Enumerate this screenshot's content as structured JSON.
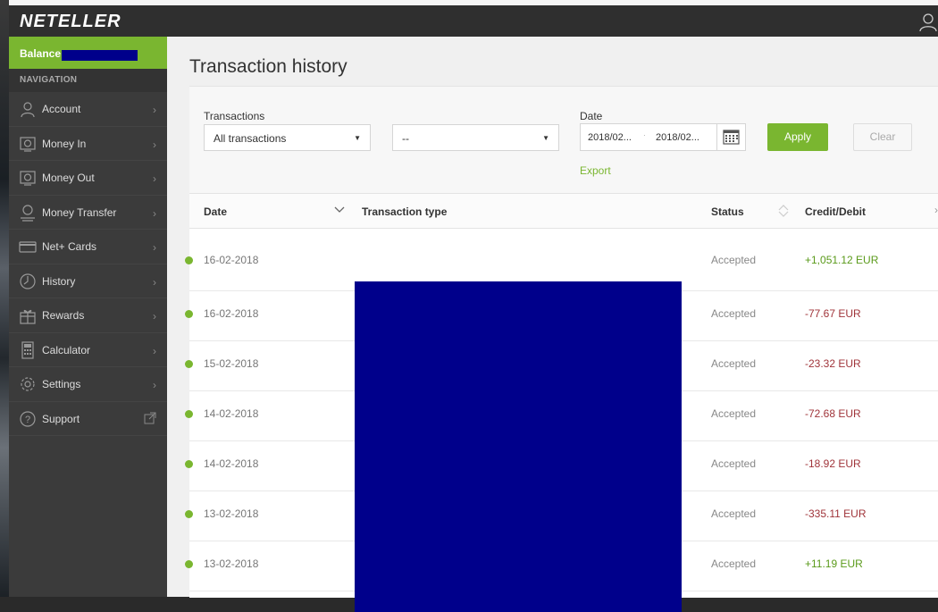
{
  "app": {
    "logo": "NETELLER"
  },
  "sidebar": {
    "balance_label": "Balance:",
    "nav_title": "NAVIGATION",
    "items": [
      {
        "label": "Account",
        "icon": "user-icon",
        "end": "›"
      },
      {
        "label": "Money In",
        "icon": "money-in-icon",
        "end": "›"
      },
      {
        "label": "Money Out",
        "icon": "money-out-icon",
        "end": "›"
      },
      {
        "label": "Money Transfer",
        "icon": "transfer-icon",
        "end": "›"
      },
      {
        "label": "Net+ Cards",
        "icon": "card-icon",
        "end": "›"
      },
      {
        "label": "History",
        "icon": "history-icon",
        "end": "›"
      },
      {
        "label": "Rewards",
        "icon": "gift-icon",
        "end": "›"
      },
      {
        "label": "Calculator",
        "icon": "calculator-icon",
        "end": "›"
      },
      {
        "label": "Settings",
        "icon": "gear-icon",
        "end": "›"
      },
      {
        "label": "Support",
        "icon": "help-icon",
        "end": "external"
      }
    ]
  },
  "main": {
    "title": "Transaction history",
    "filters": {
      "transactions_label": "Transactions",
      "transactions_value": "All transactions",
      "second_value": "--",
      "date_label": "Date",
      "date_from": "2018/02...",
      "date_to": "2018/02...",
      "apply_label": "Apply",
      "clear_label": "Clear",
      "export_label": "Export"
    },
    "table": {
      "headers": {
        "date": "Date",
        "type": "Transaction type",
        "status": "Status",
        "amount": "Credit/Debit"
      },
      "rows": [
        {
          "date": "16-02-2018",
          "status": "Accepted",
          "amount": "+1,051.12 EUR",
          "sign": "pos"
        },
        {
          "date": "16-02-2018",
          "status": "Accepted",
          "amount": "-77.67 EUR",
          "sign": "neg"
        },
        {
          "date": "15-02-2018",
          "status": "Accepted",
          "amount": "-23.32 EUR",
          "sign": "neg"
        },
        {
          "date": "14-02-2018",
          "status": "Accepted",
          "amount": "-72.68 EUR",
          "sign": "neg"
        },
        {
          "date": "14-02-2018",
          "status": "Accepted",
          "amount": "-18.92 EUR",
          "sign": "neg"
        },
        {
          "date": "13-02-2018",
          "status": "Accepted",
          "amount": "-335.11 EUR",
          "sign": "neg"
        },
        {
          "date": "13-02-2018",
          "status": "Accepted",
          "amount": "+11.19 EUR",
          "sign": "pos"
        }
      ]
    }
  },
  "colors": {
    "accent": "#7ab630",
    "credit": "#5a9a1a",
    "debit": "#a0343a",
    "redaction": "#00008b"
  }
}
